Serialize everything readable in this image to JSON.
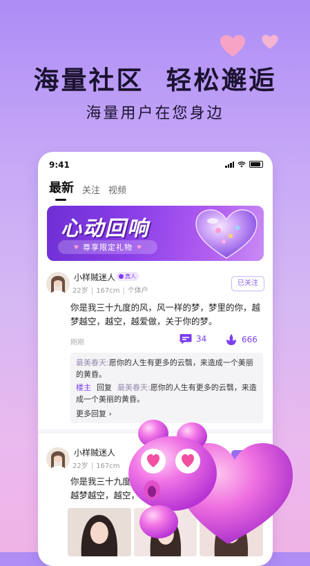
{
  "promo": {
    "headline_left": "海量社区",
    "headline_right": "轻松邂逅",
    "subline": "海量用户在您身边"
  },
  "status_bar": {
    "time": "9:41"
  },
  "tabs": [
    {
      "label": "最新",
      "active": true
    },
    {
      "label": "关注",
      "active": false
    },
    {
      "label": "视频",
      "active": false
    }
  ],
  "banner": {
    "title": "心动回响",
    "pill": "尊享限定礼物"
  },
  "posts": [
    {
      "username": "小样贼迷人",
      "badge": "真人",
      "age": "22岁",
      "height": "167cm",
      "job": "个体户",
      "follow_label": "已关注",
      "content": "你是我三十九度的风，风一样的梦，梦里的你，越梦越空，越空，越爱做，关于你的梦。",
      "time_ago": "刚刚",
      "comments": "34",
      "likes": "666",
      "replies": [
        {
          "who": "最美春天:",
          "text": "愿你的人生有更多的云翳，来造成一个美丽的黄昏。"
        }
      ],
      "reply_line2": {
        "host_tag": "楼主",
        "action": "回复",
        "who": "最美春天:",
        "text": "愿你的人生有更多的云翳，来造成一个美丽的黄昏。"
      },
      "more_replies": "更多回复"
    },
    {
      "username": "小样贼迷人",
      "age": "22岁",
      "height": "167cm",
      "follow_label": "关注",
      "content_line1": "你是我三十九度的",
      "content_line2": "越梦越空，越空，"
    }
  ],
  "colors": {
    "accent": "#7b3ff0",
    "background_top": "#ad8df5",
    "background_bottom": "#f0b3e6",
    "banner": "#8b3fe8"
  }
}
